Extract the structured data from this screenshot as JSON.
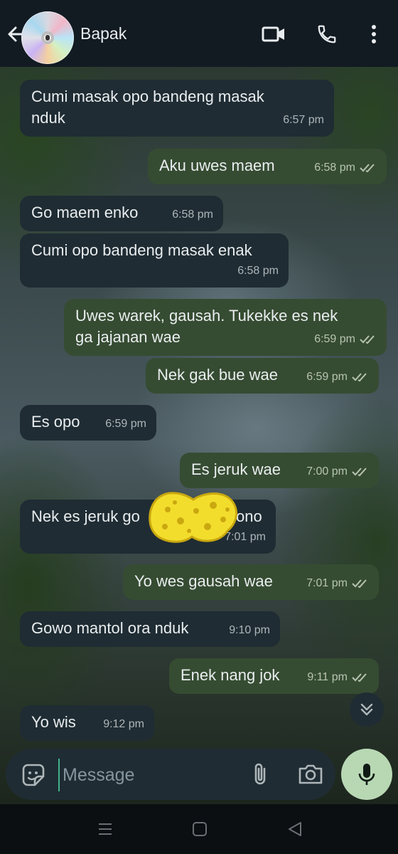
{
  "header": {
    "contact_name": "Bapak",
    "icons": [
      "back-arrow-icon",
      "cd-avatar",
      "video-call-icon",
      "phone-icon",
      "more-options-icon"
    ]
  },
  "messages": [
    {
      "direction": "in",
      "text": "Cumi masak opo bandeng masak\nnduk",
      "time": "6:57 pm"
    },
    {
      "direction": "out",
      "text": "Aku uwes maem",
      "time": "6:58 pm"
    },
    {
      "direction": "in",
      "text": "Go maem enko",
      "time": "6:58 pm"
    },
    {
      "direction": "in",
      "text": "Cumi opo bandeng masak enak",
      "time": "6:58 pm"
    },
    {
      "direction": "out",
      "text": "Uwes warek, gausah. Tukekke es nek\nga jajanan wae",
      "time": "6:59 pm"
    },
    {
      "direction": "out",
      "text": "Nek gak bue wae",
      "time": "6:59 pm"
    },
    {
      "direction": "in",
      "text": "Es opo",
      "time": "6:59 pm"
    },
    {
      "direction": "out",
      "text": "Es jeruk wae",
      "time": "7:00 pm"
    },
    {
      "direction": "in",
      "text_left": "Nek es jeruk go",
      "text_right": "ono",
      "time": "7:01 pm"
    },
    {
      "direction": "out",
      "text": "Yo wes gausah wae",
      "time": "7:01 pm"
    },
    {
      "direction": "in",
      "text": "Gowo mantol ora nduk",
      "time": "9:10 pm"
    },
    {
      "direction": "out",
      "text": "Enek nang jok",
      "time": "9:11 pm"
    },
    {
      "direction": "in",
      "text": "Yo wis",
      "time": "9:12 pm"
    }
  ],
  "composer": {
    "placeholder": "Message",
    "icons": [
      "sticker-icon",
      "attach-icon",
      "camera-icon",
      "mic-icon"
    ]
  },
  "colors": {
    "header_bg": "#121b22",
    "incoming_bubble": "#1f2c33",
    "outgoing_bubble": "#364c32",
    "mic_button": "#b8d8b4"
  },
  "navbar": {
    "icons": [
      "recent-apps-icon",
      "home-icon",
      "back-icon"
    ]
  }
}
